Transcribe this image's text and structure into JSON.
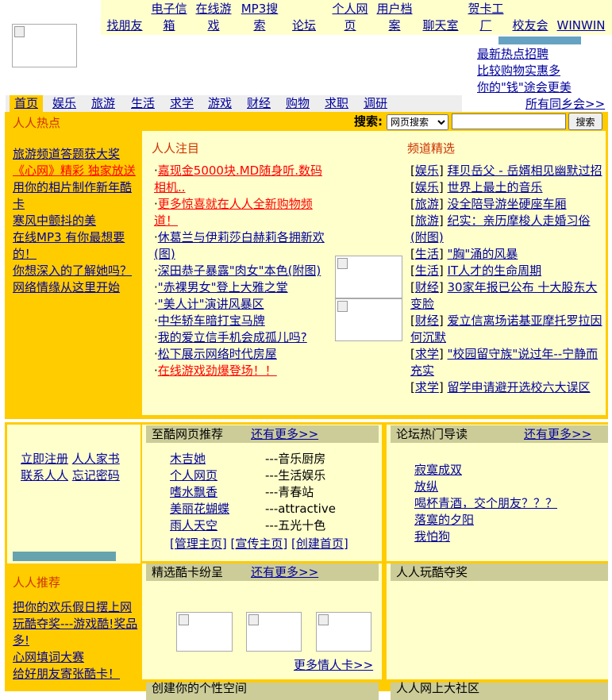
{
  "logo_alt": "",
  "top_nav": [
    "找朋友",
    "电子信箱",
    "在线游戏",
    "MP3搜索",
    "论坛",
    "个人网页",
    "用户档案",
    "聊天室",
    "贺卡工厂",
    "校友会",
    "WINWIN"
  ],
  "top_promos": [
    "最新热点招聘",
    "比较购物实惠多",
    "你的\"钱\"途会更美"
  ],
  "tabs": [
    "首页",
    "娱乐",
    "旅游",
    "生活",
    "求学",
    "游戏",
    "财经",
    "购物",
    "求职",
    "调研"
  ],
  "all_alumni": "所有同乡会>>",
  "hot": {
    "title": "人人热点",
    "items": [
      "旅游频道答题获大奖",
      "《心网》精彩 独家放送",
      "用你的相片制作新年酷卡",
      "寒风中颤抖的美",
      "在线MP3 有你最想要的！",
      "你想深入的了解她吗？",
      "网络情缘从这里开始"
    ]
  },
  "search": {
    "label": "搜索:",
    "option": "网页搜索",
    "button": "搜索",
    "value": ""
  },
  "focus": {
    "title": "人人注目",
    "items": [
      {
        "text": "嘉现金5000块.MD随身听.数码相机..",
        "red": true
      },
      {
        "text": "更多惊喜就在人人全新购物频道！",
        "red": true
      },
      {
        "text": "休葛兰与伊莉莎白赫莉各拥新欢(图)",
        "red": false
      },
      {
        "text": "深田恭子暴露\"肉女\"本色(附图)",
        "red": false
      },
      {
        "text": "\"赤裸男女\"登上大雅之堂",
        "red": false
      },
      {
        "text": "\"美人计\"演讲风暴区",
        "red": false
      },
      {
        "text": "中华轿车暗打宝马牌",
        "red": false
      },
      {
        "text": "我的爱立信手机会成孤儿吗?",
        "red": false
      },
      {
        "text": "松下展示网络时代房屋",
        "red": false
      },
      {
        "text": "在线游戏劲爆登场！！",
        "red": true
      }
    ]
  },
  "channel": {
    "title": "频道精选",
    "items": [
      {
        "tag": "娱乐",
        "text": "拜贝岳父 - 岳婿相见幽默过招"
      },
      {
        "tag": "娱乐",
        "text": "世界上最土的音乐"
      },
      {
        "tag": "旅游",
        "text": "没全陪导游坐硬座车厢"
      },
      {
        "tag": "旅游",
        "text": "纪实：亲历摩梭人走婚习俗(附图)"
      },
      {
        "tag": "生活",
        "text": "\"胸\"涌的风暴"
      },
      {
        "tag": "生活",
        "text": "IT人才的生命周期"
      },
      {
        "tag": "财经",
        "text": "30家年报已公布 十大股东大变脸"
      },
      {
        "tag": "财经",
        "text": "爱立信离场诺基亚摩托罗拉因何沉默"
      },
      {
        "tag": "求学",
        "text": "\"校园留守族\"说过年--宁静而充实"
      },
      {
        "tag": "求学",
        "text": "留学申请避开选校六大误区"
      }
    ]
  },
  "member_links": [
    "立即注册",
    "人人家书",
    "联系人人",
    "忘记密码"
  ],
  "cool_pages": {
    "title": "至酷网页推荐",
    "more": "还有更多>>",
    "rows": [
      {
        "name": "木吉她",
        "desc": "---音乐厨房"
      },
      {
        "name": "个人网页",
        "desc": "---生活娱乐"
      },
      {
        "name": "嗜水飘香",
        "desc": "---青春站"
      },
      {
        "name": "美丽花蝴蝶",
        "desc": "---attractive"
      },
      {
        "name": "雨人天空",
        "desc": "---五光十色"
      }
    ],
    "actions": [
      "[管理主页]",
      "[宣传主页]",
      "[创建首页]"
    ]
  },
  "forum": {
    "title": "论坛热门导读",
    "more": "还有更多>>",
    "items": [
      "寂寞成双",
      "放纵",
      "喝杯青酒，交个朋友？？？",
      "落寞的夕阳",
      "我怕狗"
    ]
  },
  "recommend": {
    "title": "人人推荐",
    "items": [
      "把你的欢乐假日摆上网",
      "玩酷夺奖---游戏酷!奖品多!",
      "心网填词大赛",
      "给好朋友寄张酷卡！"
    ]
  },
  "cards": {
    "title": "精选酷卡纷呈",
    "more": "还有更多>>",
    "more_cards": "更多情人卡>>"
  },
  "fun": {
    "title": "人人玩酷夺奖"
  },
  "bottom_left_title": "创建你的个性空间",
  "bottom_right_title": "人人网上大社区"
}
